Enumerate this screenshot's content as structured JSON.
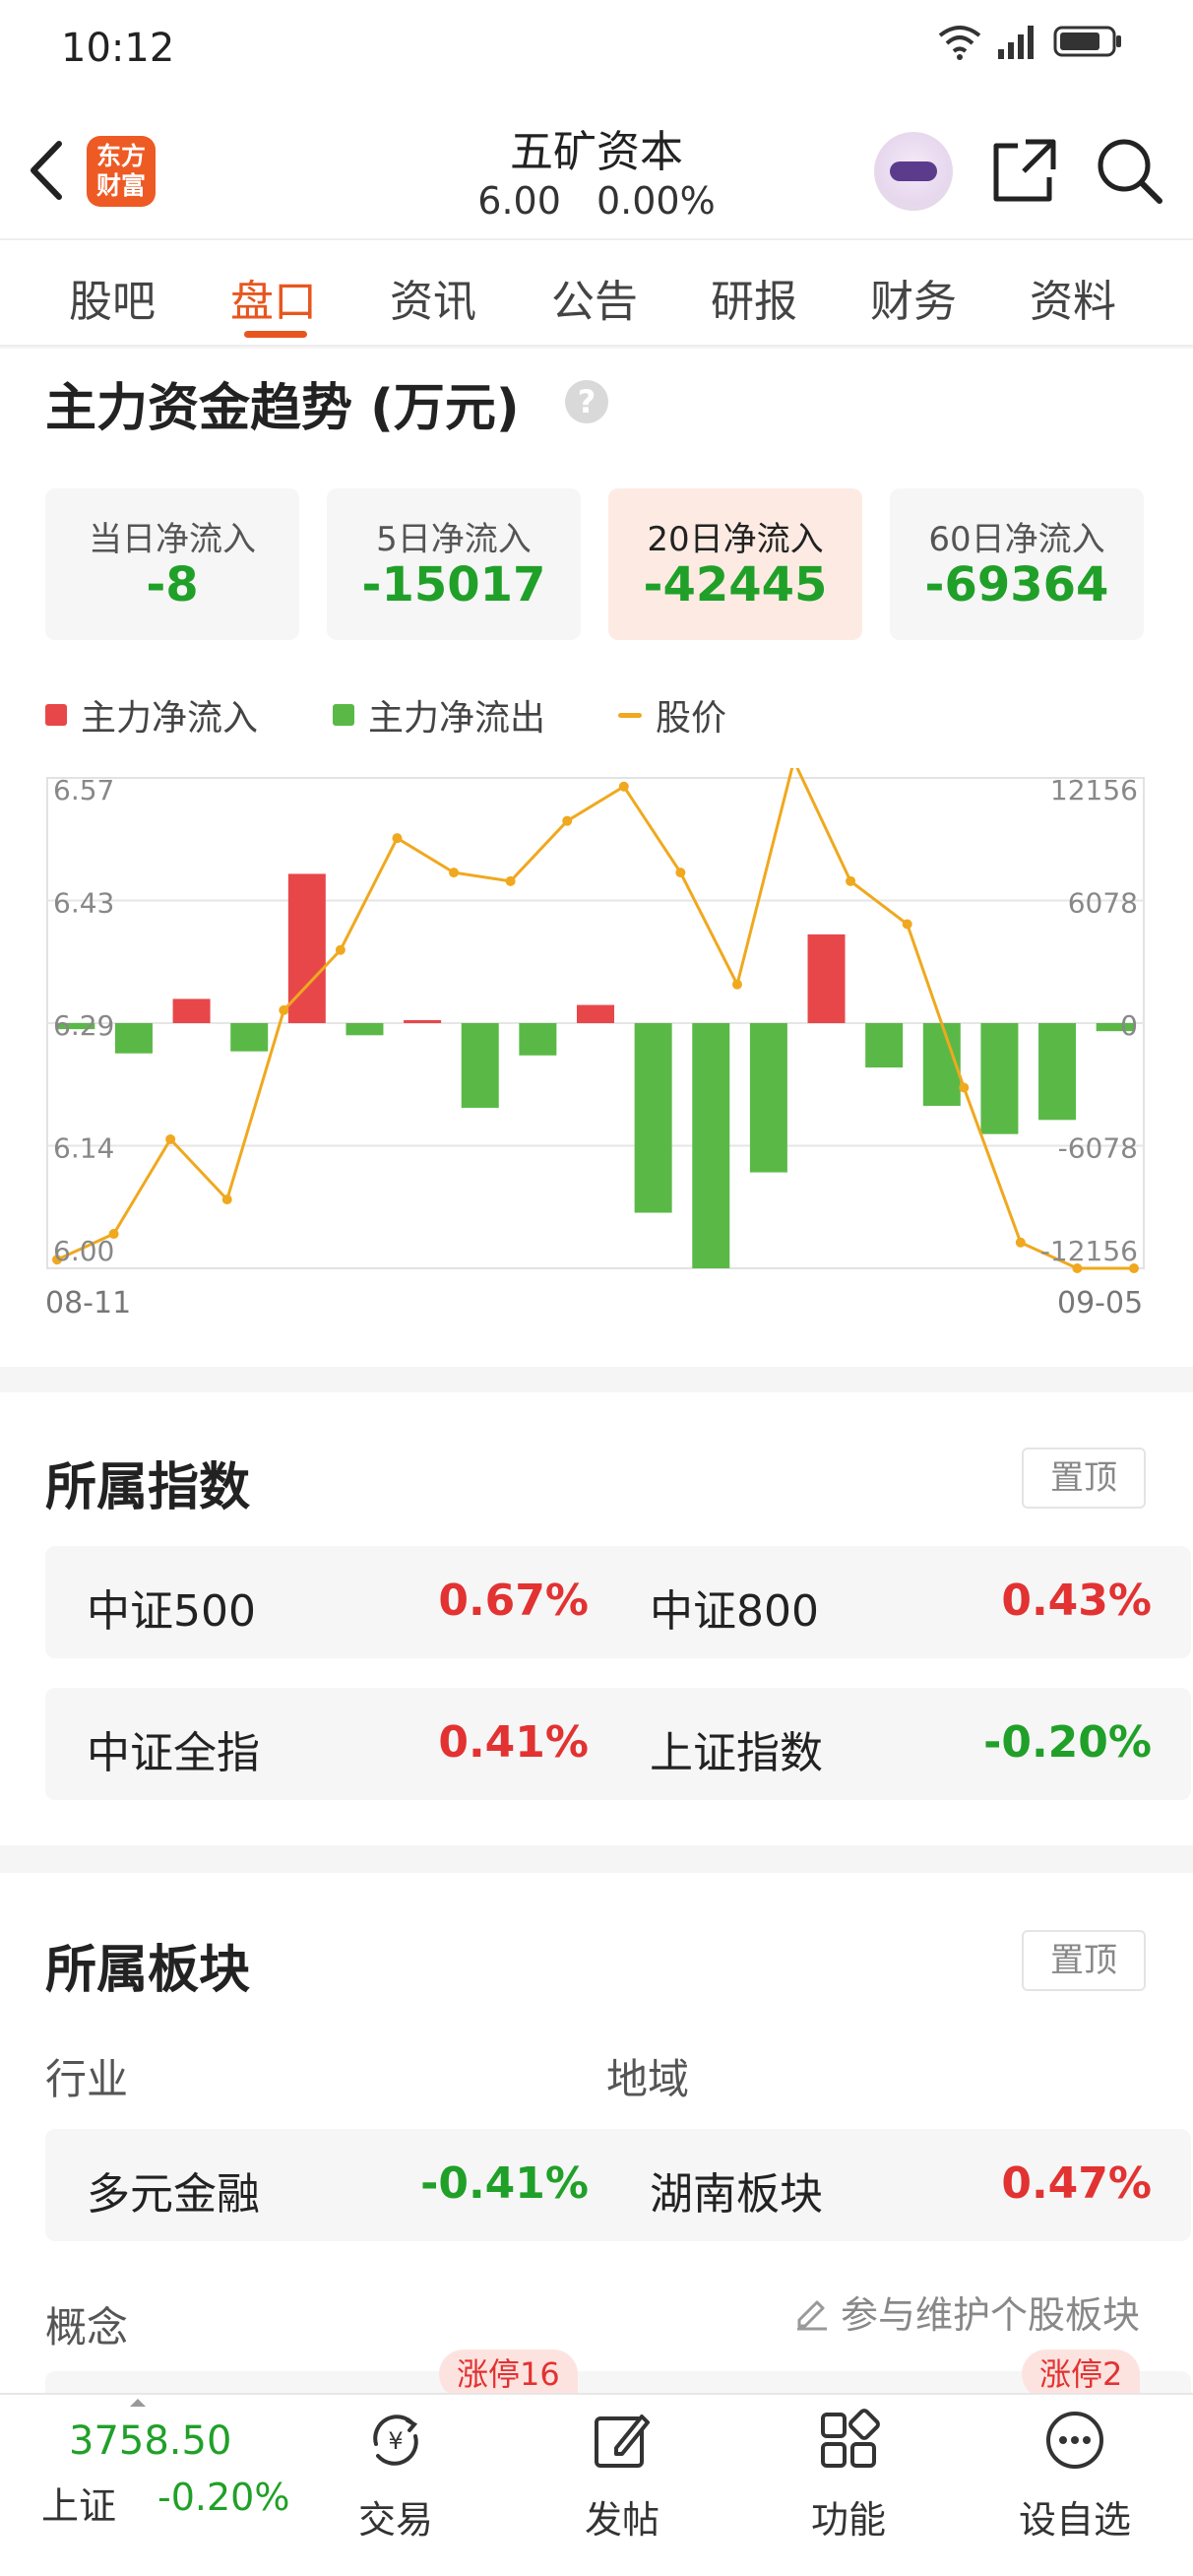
{
  "status": {
    "time": "10:12"
  },
  "header": {
    "logo_line1": "东方",
    "logo_line2": "财富",
    "name": "五矿资本",
    "price": "6.00",
    "change_pct": "0.00%"
  },
  "tabs": [
    "股吧",
    "盘口",
    "资讯",
    "公告",
    "研报",
    "财务",
    "资料"
  ],
  "active_tab": "盘口",
  "capital": {
    "title": "主力资金趋势 (万元)",
    "help": "?",
    "cards": [
      {
        "label": "当日净流入",
        "value": "-8"
      },
      {
        "label": "5日净流入",
        "value": "-15017"
      },
      {
        "label": "20日净流入",
        "value": "-42445"
      },
      {
        "label": "60日净流入",
        "value": "-69364"
      }
    ],
    "legend": {
      "inflow": "主力净流入",
      "outflow": "主力净流出",
      "price": "股价"
    }
  },
  "chart_data": {
    "type": "bar",
    "x_start_label": "08-11",
    "x_end_label": "09-05",
    "left_axis_ticks": [
      "6.57",
      "6.43",
      "6.29",
      "6.14",
      "6.00"
    ],
    "right_axis_ticks": [
      "12156",
      "6078",
      "0",
      "-6078",
      "-12156"
    ],
    "bar_ylim": [
      -12156,
      12156
    ],
    "line_ylim": [
      6.0,
      6.57
    ],
    "series": [
      {
        "name": "主力净流入/流出",
        "values": [
          -300,
          -1500,
          1200,
          -1400,
          7400,
          -600,
          150,
          -4200,
          -1600,
          900,
          -9400,
          -12156,
          -7400,
          4400,
          -2200,
          -4100,
          -5500,
          -4800,
          -400
        ]
      },
      {
        "name": "股价",
        "values": [
          6.01,
          6.04,
          6.15,
          6.08,
          6.3,
          6.37,
          6.5,
          6.46,
          6.45,
          6.52,
          6.56,
          6.46,
          6.33,
          6.59,
          6.45,
          6.4,
          6.21,
          6.03,
          6.0,
          6.0
        ]
      }
    ],
    "colors": {
      "inflow": "#e8474a",
      "outflow": "#5ab946",
      "price": "#f0a81e"
    }
  },
  "indices": {
    "title": "所属指数",
    "pin": "置顶",
    "items": [
      {
        "name": "中证500",
        "value": "0.67%",
        "dir": "up"
      },
      {
        "name": "中证800",
        "value": "0.43%",
        "dir": "up"
      },
      {
        "name": "中证全指",
        "value": "0.41%",
        "dir": "up"
      },
      {
        "name": "上证指数",
        "value": "-0.20%",
        "dir": "down"
      }
    ]
  },
  "sectors": {
    "title": "所属板块",
    "pin": "置顶",
    "industry_label": "行业",
    "region_label": "地域",
    "industry": {
      "name": "多元金融",
      "value": "-0.41%"
    },
    "region": {
      "name": "湖南板块",
      "value": "0.47%"
    },
    "concept_label": "概念",
    "maintain_link": "参与维护个股板块",
    "badge_left": "涨停16",
    "badge_right": "涨停2"
  },
  "bottom": {
    "index_price": "3758.50",
    "index_label": "上证",
    "index_change": "-0.20%",
    "items": [
      "交易",
      "发帖",
      "功能",
      "设自选"
    ]
  }
}
